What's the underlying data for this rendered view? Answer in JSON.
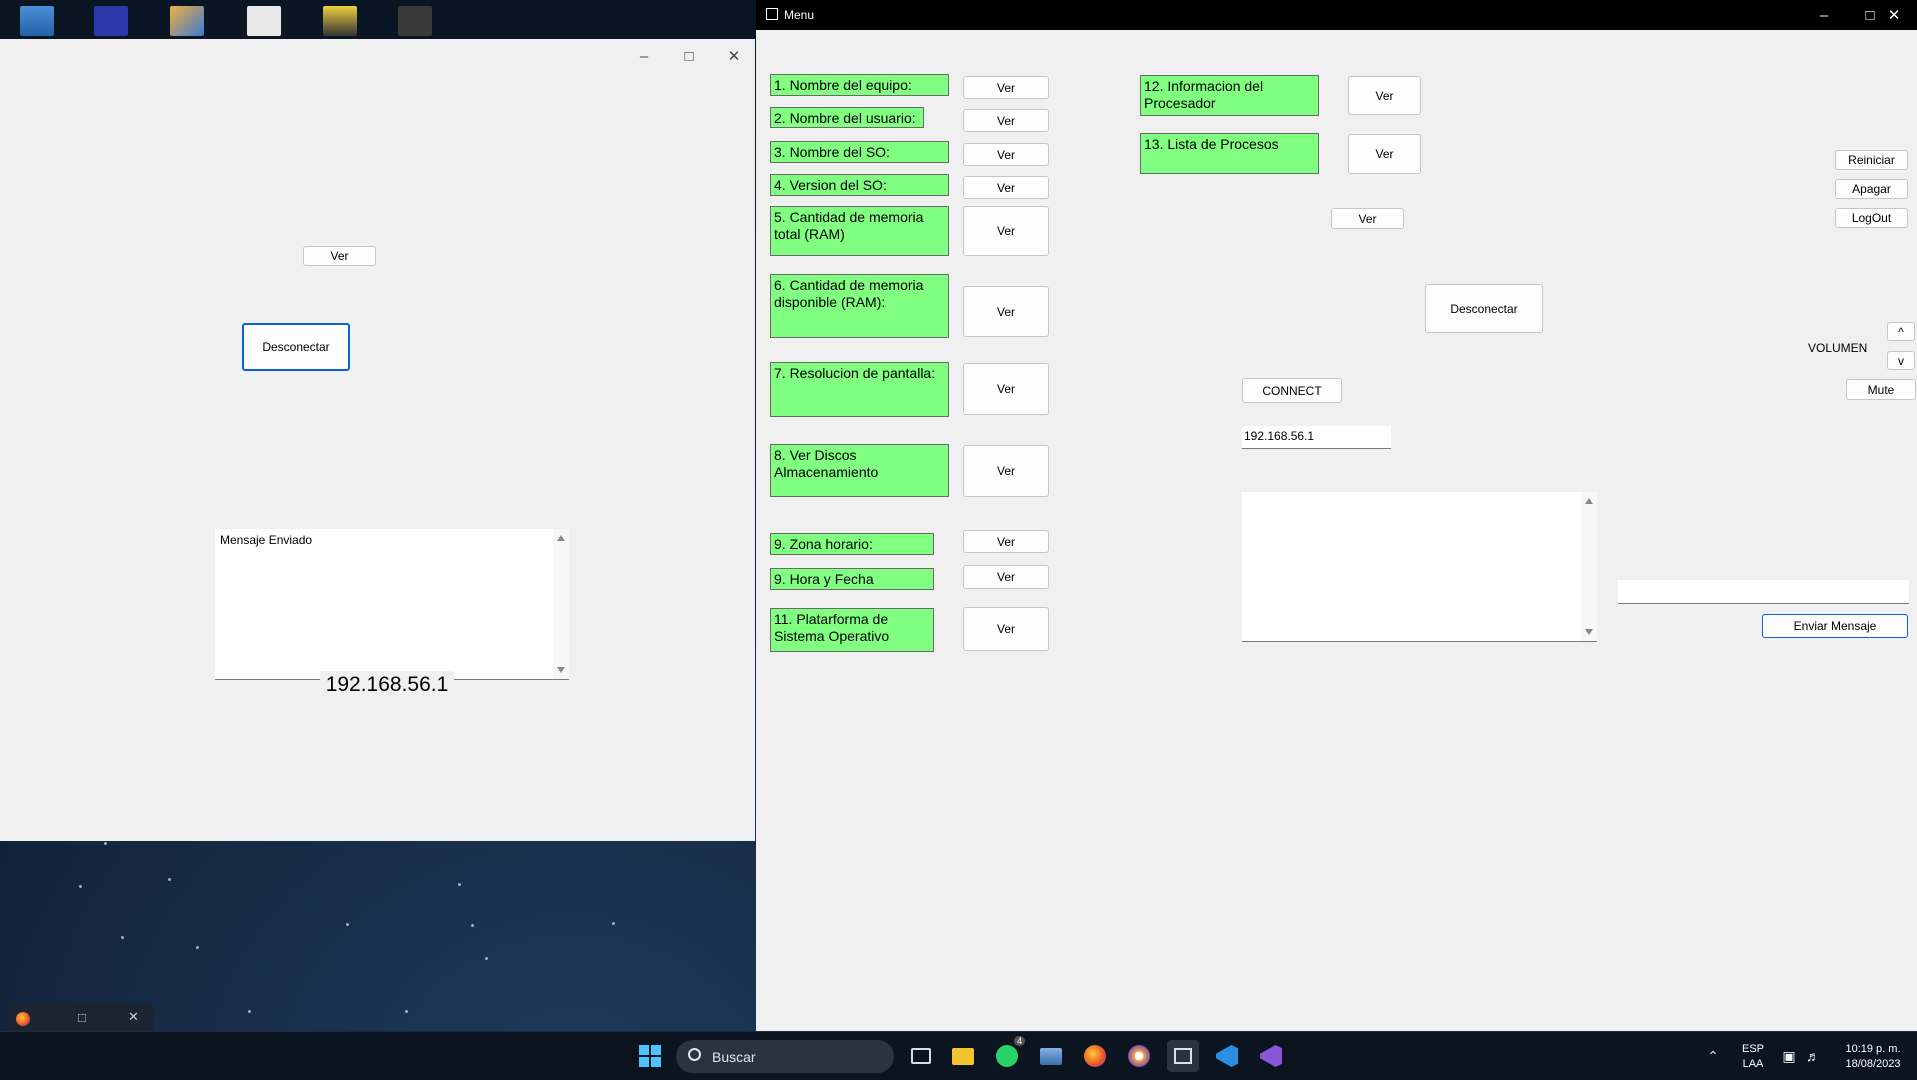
{
  "left_window": {
    "ver_label": "Ver",
    "disconnect_label": "Desconectar",
    "message_text": "Mensaje Enviado",
    "ip_display": "192.168.56.1"
  },
  "menu_window": {
    "title": "Menu",
    "info_items": [
      {
        "label": "1. Nombre del equipo:",
        "button": "Ver"
      },
      {
        "label": "2. Nombre del usuario:",
        "button": "Ver"
      },
      {
        "label": "3. Nombre del SO:",
        "button": "Ver"
      },
      {
        "label": "4. Version del SO:",
        "button": "Ver"
      },
      {
        "label": "5. Cantidad de memoria total (RAM)",
        "button": "Ver"
      },
      {
        "label": "6. Cantidad de memoria disponible (RAM):",
        "button": "Ver"
      },
      {
        "label": "7. Resolucion de pantalla:",
        "button": "Ver"
      },
      {
        "label": "8. Ver Discos Almacenamiento",
        "button": "Ver"
      },
      {
        "label": "9. Zona horario:",
        "button": "Ver"
      },
      {
        "label": "9. Hora y Fecha",
        "button": "Ver"
      },
      {
        "label": "11. Platarforma de Sistema Operativo",
        "button": "Ver"
      },
      {
        "label": "12. Informacion del Procesador",
        "button": "Ver"
      },
      {
        "label": "13. Lista de Procesos",
        "button": "Ver"
      }
    ],
    "extra_ver": "Ver",
    "disconnect_label": "Desconectar",
    "connect_label": "CONNECT",
    "ip_input_value": "192.168.56.1",
    "power": {
      "restart": "Reiniciar",
      "shutdown": "Apagar",
      "logout": "LogOut"
    },
    "volume": {
      "label": "VOLUMEN",
      "up": "^",
      "down": "v",
      "mute": "Mute"
    },
    "message_input_value": "",
    "send_label": "Enviar Mensaje"
  },
  "taskbar": {
    "search_placeholder": "Buscar",
    "whatsapp_badge": "4",
    "language": "ESP",
    "keyboard_layout": "LAA",
    "time": "10:19 p. m.",
    "date": "18/08/2023"
  },
  "colors": {
    "label_green": "#80ff80",
    "title_bar": "#000000",
    "focus_blue": "#0a64d6"
  }
}
